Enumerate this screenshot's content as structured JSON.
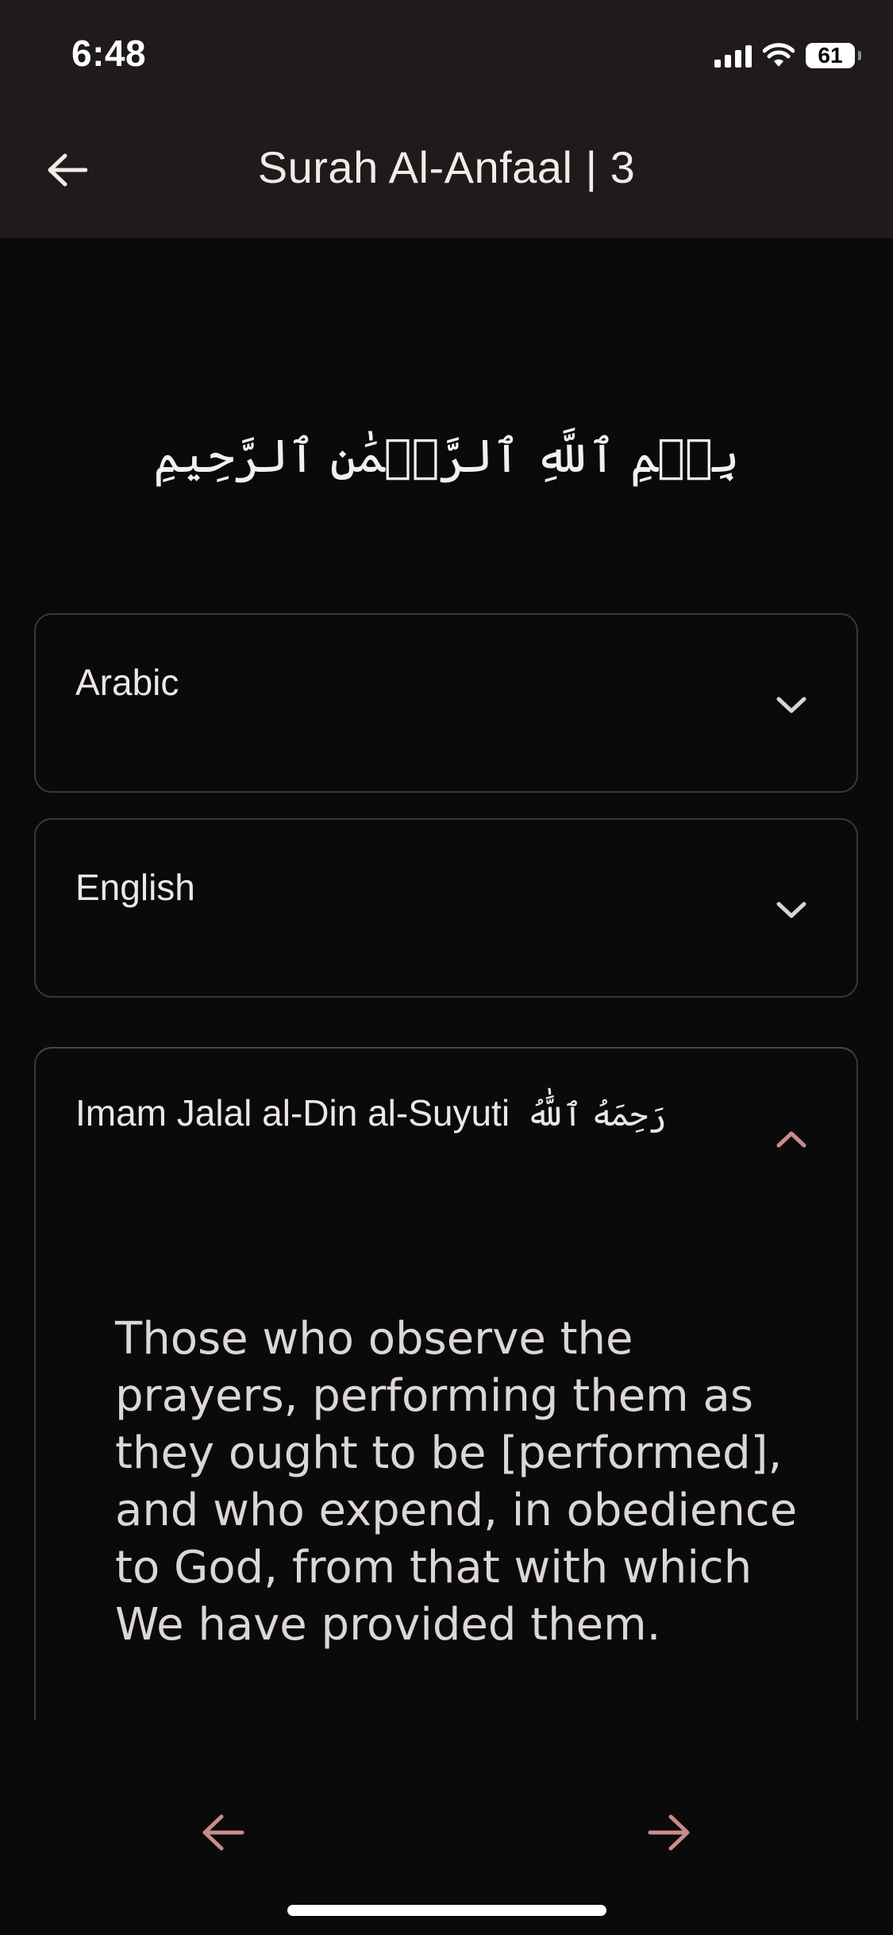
{
  "status_bar": {
    "time": "6:48",
    "battery": "61",
    "icons": [
      "signal-icon",
      "wifi-icon",
      "battery-icon"
    ]
  },
  "app_bar": {
    "title": "Surah Al-Anfaal | 3",
    "back_icon": "back-arrow-icon"
  },
  "bismillah": "بِسۡمِ ٱللَّهِ ٱلرَّحۡمَٰنِ ٱلرَّحِيمِ",
  "panels": [
    {
      "label": "Arabic",
      "state": "collapsed",
      "icon": "chevron-down-icon"
    },
    {
      "label": "English",
      "state": "collapsed",
      "icon": "chevron-down-icon"
    },
    {
      "label": "Imam Jalal al-Din al-Suyuti",
      "honorific": "رَحِمَهُ ٱللَّٰهُ",
      "state": "expanded",
      "icon": "chevron-up-icon",
      "text": "Those who observe the prayers, performing them as they ought to be [performed], and who expend, in obedience to God, from that with which We have provided them."
    }
  ],
  "bottom_nav": {
    "prev_icon": "arrow-left-icon",
    "next_icon": "arrow-right-icon"
  },
  "colors": {
    "background": "#0b0a0a",
    "app_bar": "#1f1b1a",
    "accent": "#c98c8c",
    "border": "#3c3736",
    "text": "#ece7e5"
  }
}
